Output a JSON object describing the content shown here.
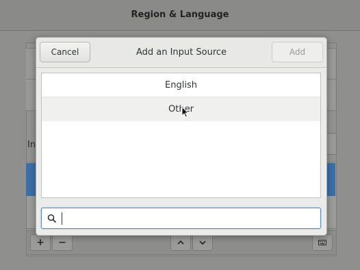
{
  "parent_window": {
    "title": "Region & Language",
    "section_label": "In",
    "toolbar": {
      "add_label": "+",
      "remove_label": "−"
    }
  },
  "dialog": {
    "title": "Add an Input Source",
    "cancel_label": "Cancel",
    "add_label": "Add",
    "add_enabled": false,
    "list_items": [
      "English",
      "Other"
    ],
    "hovered_item": "Other",
    "search": {
      "placeholder": "",
      "value": ""
    }
  },
  "icons": {
    "search": "search-icon",
    "move_up": "chevron-up-icon",
    "move_down": "chevron-down-icon",
    "keyboard": "keyboard-icon",
    "pointer": "mouse-pointer-icon"
  },
  "colors": {
    "selection_blue": "#3a6fa8",
    "focus_ring": "#4a90d9",
    "dialog_bg": "#ebebea",
    "dimmed_bg": "#8f8f8e"
  }
}
